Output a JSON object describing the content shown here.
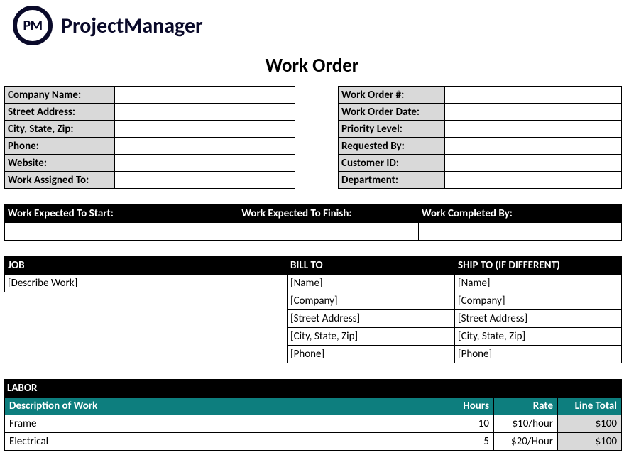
{
  "brand": "ProjectManager",
  "logo_text": "PM",
  "title": "Work Order",
  "company_block": {
    "labels": {
      "company_name": "Company Name:",
      "street_address": "Street Address:",
      "city_state_zip": "City, State, Zip:",
      "phone": "Phone:",
      "website": "Website:",
      "work_assigned_to": "Work Assigned To:"
    },
    "values": {
      "company_name": "",
      "street_address": "",
      "city_state_zip": "",
      "phone": "",
      "website": "",
      "work_assigned_to": ""
    }
  },
  "order_block": {
    "labels": {
      "work_order_num": "Work Order #:",
      "work_order_date": "Work Order Date:",
      "priority_level": "Priority Level:",
      "requested_by": "Requested By:",
      "customer_id": "Customer ID:",
      "department": "Department:"
    },
    "values": {
      "work_order_num": "",
      "work_order_date": "",
      "priority_level": "",
      "requested_by": "",
      "customer_id": "",
      "department": ""
    }
  },
  "dates": {
    "labels": {
      "start": "Work Expected To Start:",
      "finish": "Work Expected To Finish:",
      "completed": "Work Completed By:"
    },
    "values": {
      "start": "",
      "finish": "",
      "completed": ""
    }
  },
  "job_section": {
    "headers": {
      "job": "JOB",
      "bill_to": "BILL TO",
      "ship_to": "SHIP TO (IF DIFFERENT)"
    },
    "job_description": "[Describe Work]",
    "bill_to": {
      "name": "[Name]",
      "company": "[Company]",
      "street": "[Street Address]",
      "csz": "[City, State, Zip]",
      "phone": "[Phone]"
    },
    "ship_to": {
      "name": "[Name]",
      "company": "[Company]",
      "street": "[Street Address]",
      "csz": "[City, State, Zip]",
      "phone": "[Phone]"
    }
  },
  "labor": {
    "section_label": "LABOR",
    "headers": {
      "desc": "Description of Work",
      "hours": "Hours",
      "rate": "Rate",
      "line_total": "Line Total"
    },
    "rows": [
      {
        "desc": "Frame",
        "hours": "10",
        "rate": "$10/hour",
        "line_total": "$100"
      },
      {
        "desc": "Electrical",
        "hours": "5",
        "rate": "$20/Hour",
        "line_total": "$100"
      }
    ]
  }
}
